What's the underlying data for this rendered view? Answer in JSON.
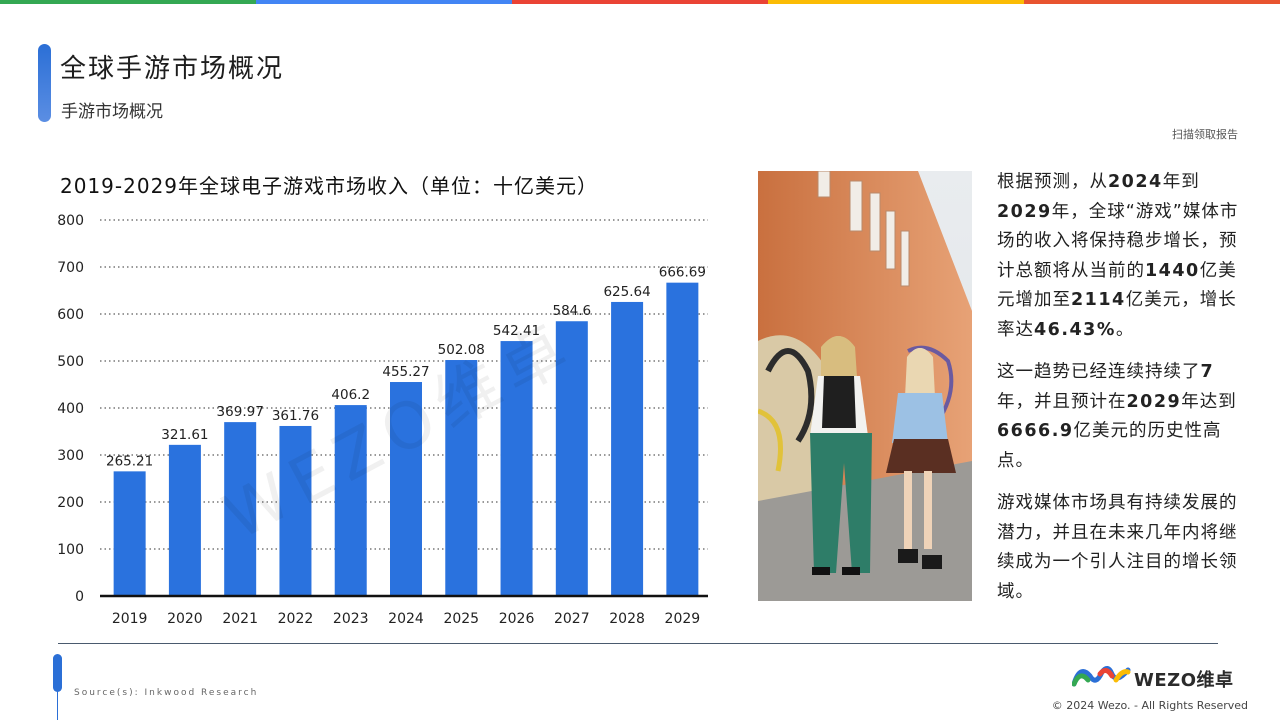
{
  "colors": {
    "top_bar": [
      "#34a853",
      "#4285f4",
      "#ea4335",
      "#fbbc05",
      "#e8542f"
    ],
    "bar": "#2a72de",
    "accent": "#2b6fd6"
  },
  "header": {
    "title": "全球手游市场概况",
    "subtitle": "手游市场概况",
    "scan_link": "扫描领取报告"
  },
  "chart_data": {
    "type": "bar",
    "title": "2019-2029年全球电子游戏市场收入（单位：十亿美元）",
    "categories": [
      "2019",
      "2020",
      "2021",
      "2022",
      "2023",
      "2024",
      "2025",
      "2026",
      "2027",
      "2028",
      "2029"
    ],
    "values": [
      265.21,
      321.61,
      369.97,
      361.76,
      406.2,
      455.27,
      502.08,
      542.41,
      584.6,
      625.64,
      666.69
    ],
    "value_labels": [
      "265.21",
      "321.61",
      "369.97",
      "361.76",
      "406.2",
      "455.27",
      "502.08",
      "542.41",
      "584.6",
      "625.64",
      "666.69"
    ],
    "ylim": [
      0,
      800
    ],
    "yticks": [
      0,
      100,
      200,
      300,
      400,
      500,
      600,
      700,
      800
    ],
    "grid": "horizontal-dotted",
    "xlabel": "",
    "ylabel": ""
  },
  "watermark": "WEZO维卓",
  "text_block": {
    "p1": [
      {
        "t": "根据预测，从",
        "b": false
      },
      {
        "t": "2024",
        "b": true
      },
      {
        "t": "年到",
        "b": false
      },
      {
        "t": "2029",
        "b": true
      },
      {
        "t": "年，全球“游戏”媒体市场的收入将保持稳步增长，预计总额将从当前的",
        "b": false
      },
      {
        "t": "1440",
        "b": true
      },
      {
        "t": "亿美元增加至",
        "b": false
      },
      {
        "t": "2114",
        "b": true
      },
      {
        "t": "亿美元，增长率达",
        "b": false
      },
      {
        "t": "46.43%",
        "b": true
      },
      {
        "t": "。",
        "b": false
      }
    ],
    "p2": [
      {
        "t": "这一趋势已经连续持续了",
        "b": false
      },
      {
        "t": "7",
        "b": true
      },
      {
        "t": "年，并且预计在",
        "b": false
      },
      {
        "t": "2029",
        "b": true
      },
      {
        "t": "年达到",
        "b": false
      },
      {
        "t": "6666.9",
        "b": true
      },
      {
        "t": "亿美元的历史性高点。",
        "b": false
      }
    ],
    "p3": [
      {
        "t": "游戏媒体市场具有持续发展的潜力，并且在未来几年内将继续成为一个引人注目的增长领域。",
        "b": false
      }
    ]
  },
  "footer": {
    "source": "Source(s): Inkwood Research",
    "logo_text": "WEZO维卓",
    "copyright": "© 2024 Wezo. - All Rights Reserved"
  }
}
